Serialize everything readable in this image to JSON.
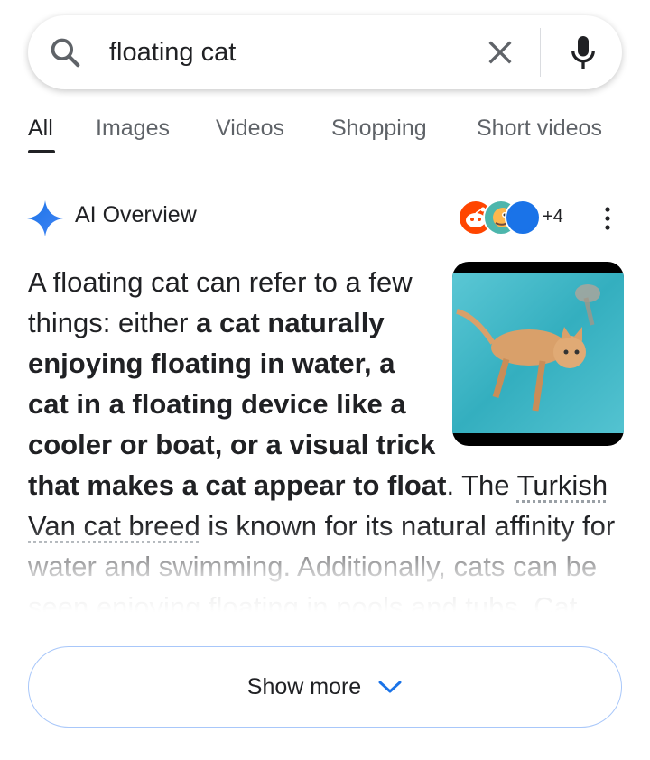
{
  "search": {
    "query": "floating cat"
  },
  "tabs": [
    {
      "label": "All",
      "active": true
    },
    {
      "label": "Images"
    },
    {
      "label": "Videos"
    },
    {
      "label": "Shopping"
    },
    {
      "label": "Short videos"
    }
  ],
  "ai_overview": {
    "title": "AI Overview",
    "source_count": "+4",
    "sources": [
      {
        "icon": "reddit-icon",
        "color": "#ff4500"
      },
      {
        "icon": "cartoon-avatar-icon",
        "color": "#ffb74d"
      },
      {
        "icon": "blue-circle-icon",
        "color": "#1a73e8"
      }
    ],
    "body": {
      "p1": "A floating cat can refer to a few things: either ",
      "b1": "a cat naturally enjoying floating in water, a cat in a floating device like a cooler or boat, or a visual trick that makes a cat appear to float",
      "p2": ". The ",
      "link": "Turkish Van cat breed",
      "p3": " is known for its natural affinity for water and swimming. Additionally, cats can be seen enjoying floating in pools and tubs. Cat lovers often share"
    },
    "show_more_label": "Show more"
  },
  "colors": {
    "accent": "#1a73e8",
    "border": "#a8c7fa",
    "spark": "#4285f4"
  }
}
